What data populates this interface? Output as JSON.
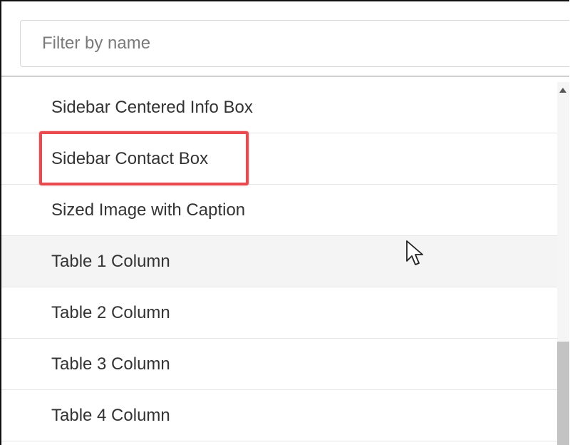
{
  "filter": {
    "placeholder": "Filter by name",
    "value": ""
  },
  "list": {
    "items": [
      {
        "label": "Sidebar Centered Info Box"
      },
      {
        "label": "Sidebar Contact Box"
      },
      {
        "label": "Sized Image with Caption"
      },
      {
        "label": "Table 1 Column"
      },
      {
        "label": "Table 2 Column"
      },
      {
        "label": "Table 3 Column"
      },
      {
        "label": "Table 4 Column"
      }
    ],
    "hovered_item": "Table 1 Column",
    "highlighted_item": "Sidebar Contact Box"
  },
  "colors": {
    "highlight": "#e84a4f",
    "text": "#333333",
    "hover_bg": "#f4f4f4"
  },
  "icons": {
    "cursor": "mouse-pointer-icon",
    "scroll_up": "scroll-up-arrow-icon"
  }
}
